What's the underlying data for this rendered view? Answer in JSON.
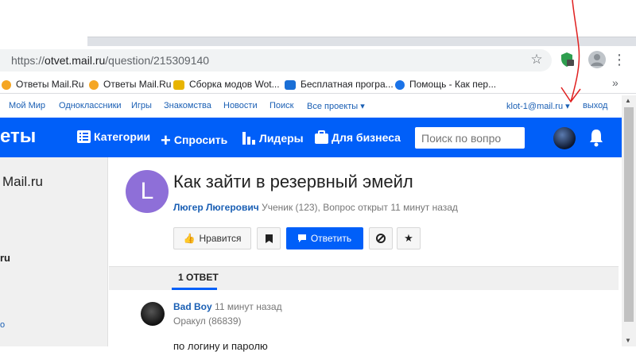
{
  "browser": {
    "url_prefix": "https://",
    "url_host": "otvet.mail.ru",
    "url_path": "/question/215309140",
    "more_symbol": "»"
  },
  "bookmarks": [
    {
      "label": "Ответы Mail.Ru",
      "icon": "question-icon"
    },
    {
      "label": "Ответы Mail.Ru",
      "icon": "question-icon"
    },
    {
      "label": "Сборка модов Wot...",
      "icon": "w-logo-icon"
    },
    {
      "label": "Бесплатная програ...",
      "icon": "m-logo-icon"
    },
    {
      "label": "Помощь - Как пер...",
      "icon": "chrome-icon"
    }
  ],
  "portal": {
    "links": [
      "Мой Мир",
      "Одноклассники",
      "Игры",
      "Знакомства",
      "Новости",
      "Поиск",
      "Все проекты"
    ],
    "user_email": "klot-1@mail.ru",
    "logout": "выход"
  },
  "header": {
    "logo": "еты",
    "nav": [
      "Категории",
      "Спросить",
      "Лидеры",
      "Для бизнеса"
    ],
    "search_placeholder": "Поиск по вопро"
  },
  "left": {
    "title": "Mail.ru",
    "text1": "ru",
    "text2": "о"
  },
  "question": {
    "avatar_letter": "L",
    "title": "Как зайти в резервный эмейл",
    "author": "Люгер Люгерович",
    "meta": "Ученик (123), Вопрос открыт 11 минут назад",
    "like_label": "Нравится",
    "answer_label": "Ответить"
  },
  "answers": {
    "tab_label": "1 ОТВЕТ",
    "items": [
      {
        "author": "Bad Boy",
        "time": "11 минут назад",
        "rank": "Оракул (86839)",
        "text": "по логину и паролю"
      }
    ]
  },
  "colors": {
    "accent": "#005ff9",
    "annotation": "#e02020",
    "avatar": "#8e6fd8"
  }
}
